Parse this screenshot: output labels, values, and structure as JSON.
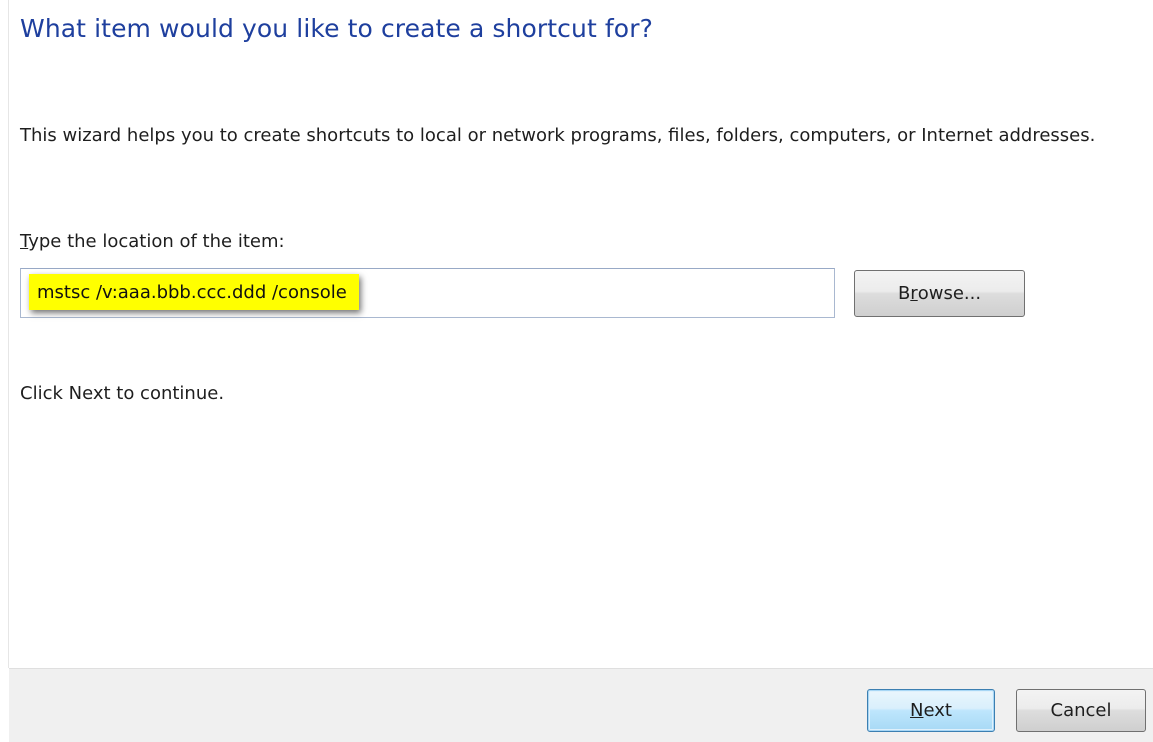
{
  "wizard": {
    "title": "What item would you like to create a shortcut for?",
    "description": "This wizard helps you to create shortcuts to local or network programs, files, folders, computers, or Internet addresses.",
    "location_label_accesskey": "T",
    "location_label_rest": "ype the location of the item:",
    "location_value": "mstsc /v:aaa.bbb.ccc.ddd /console",
    "browse": {
      "pre": "B",
      "accesskey": "r",
      "post": "owse..."
    },
    "continue_text": "Click Next to continue."
  },
  "footer": {
    "next": {
      "accesskey": "N",
      "rest": "ext"
    },
    "cancel_label": "Cancel"
  },
  "colors": {
    "title": "#1e3f9e",
    "highlight": "#ffff00",
    "footer_bg": "#f0f0f0"
  }
}
